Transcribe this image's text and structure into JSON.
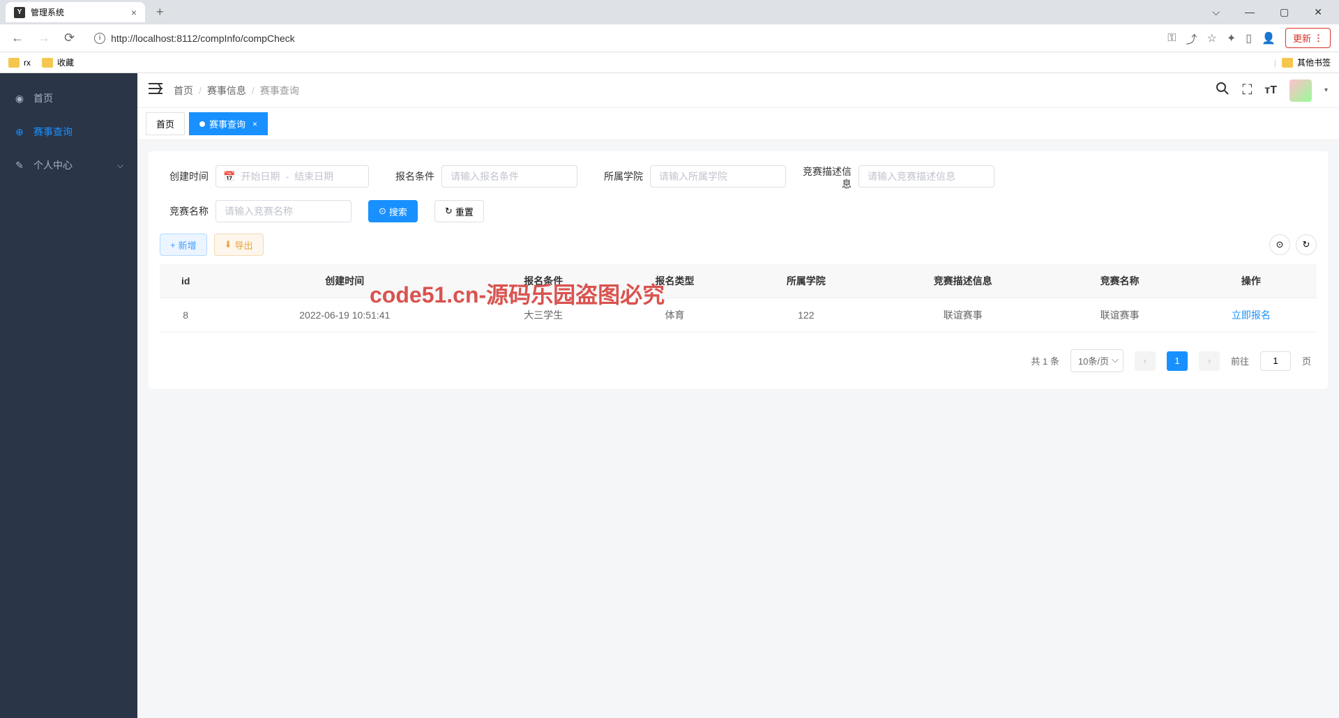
{
  "browser": {
    "tab_title": "管理系统",
    "url": "http://localhost:8112/compInfo/compCheck",
    "update_label": "更新",
    "bookmarks": [
      "rx",
      "收藏"
    ],
    "other_bookmarks": "其他书签"
  },
  "sidebar": {
    "items": [
      {
        "label": "首页",
        "icon": "dashboard"
      },
      {
        "label": "赛事查询",
        "icon": "target",
        "active": true
      },
      {
        "label": "个人中心",
        "icon": "edit",
        "expandable": true
      }
    ]
  },
  "breadcrumb": [
    "首页",
    "赛事信息",
    "赛事查询"
  ],
  "tabs": [
    {
      "label": "首页",
      "active": false
    },
    {
      "label": "赛事查询",
      "active": true
    }
  ],
  "search": {
    "create_time_label": "创建时间",
    "start_date_placeholder": "开始日期",
    "date_separator": "-",
    "end_date_placeholder": "结束日期",
    "signup_cond_label": "报名条件",
    "signup_cond_placeholder": "请输入报名条件",
    "college_label": "所属学院",
    "college_placeholder": "请输入所属学院",
    "desc_label": "竞赛描述信息",
    "desc_placeholder": "请输入竞赛描述信息",
    "name_label": "竞赛名称",
    "name_placeholder": "请输入竞赛名称",
    "search_btn": "搜索",
    "reset_btn": "重置"
  },
  "actions": {
    "add_btn": "新增",
    "export_btn": "导出"
  },
  "table": {
    "headers": [
      "id",
      "创建时间",
      "报名条件",
      "报名类型",
      "所属学院",
      "竞赛描述信息",
      "竞赛名称",
      "操作"
    ],
    "rows": [
      {
        "id": "8",
        "create_time": "2022-06-19 10:51:41",
        "signup_cond": "大三学生",
        "signup_type": "体育",
        "college": "122",
        "desc": "联谊赛事",
        "name": "联谊赛事",
        "action": "立即报名"
      }
    ]
  },
  "pagination": {
    "total_text": "共 1 条",
    "page_size": "10条/页",
    "current_page": "1",
    "jump_prefix": "前往",
    "jump_value": "1",
    "jump_suffix": "页"
  },
  "watermark": "code51.cn-源码乐园盗图必究"
}
